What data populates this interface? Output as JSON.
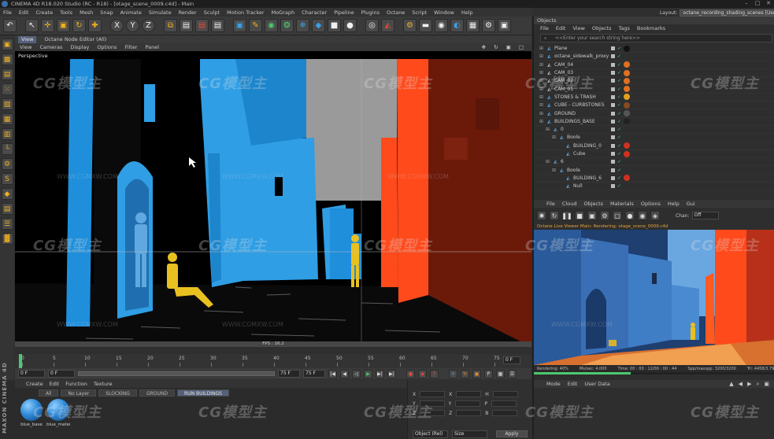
{
  "window": {
    "title": "CINEMA 4D R18.020 Studio (RC - R18) - [otage_scene_0009.c4d] - Main",
    "controls": [
      "–",
      "□",
      "✕"
    ]
  },
  "menubar": [
    "File",
    "Edit",
    "Create",
    "Tools",
    "Mesh",
    "Snap",
    "Animate",
    "Simulate",
    "Render",
    "Sculpt",
    "Motion Tracker",
    "MoGraph",
    "Character",
    "Pipeline",
    "Plugins",
    "Octane",
    "Script",
    "Window",
    "Help"
  ],
  "layout": {
    "label": "Layout:",
    "value": "octane_recording_shading_scenes [User]"
  },
  "toolbar": {
    "group1": [
      {
        "name": "undo-icon",
        "glyph": "↶",
        "tone": "w"
      }
    ],
    "group2": [
      {
        "name": "cursor-icon",
        "glyph": "↖",
        "tone": "w"
      },
      {
        "name": "move-icon",
        "glyph": "✛",
        "tone": "y"
      },
      {
        "name": "scale-icon",
        "glyph": "▣",
        "tone": "y"
      },
      {
        "name": "rotate-icon",
        "glyph": "↻",
        "tone": "y"
      },
      {
        "name": "add-object-icon",
        "glyph": "✚",
        "tone": "y"
      }
    ],
    "axes": [
      "X",
      "Y",
      "Z"
    ],
    "group3": [
      {
        "name": "coord-system-icon",
        "glyph": "⧉",
        "tone": "y"
      },
      {
        "name": "clapper-icon",
        "glyph": "▤",
        "tone": "w"
      },
      {
        "name": "render-view-icon",
        "glyph": "▤",
        "tone": "r"
      },
      {
        "name": "render-settings-icon",
        "glyph": "▤",
        "tone": "w"
      }
    ],
    "group4": [
      {
        "name": "cube-icon",
        "glyph": "▣",
        "tone": "b"
      },
      {
        "name": "pen-icon",
        "glyph": "✎",
        "tone": "y"
      },
      {
        "name": "subdivision-icon",
        "glyph": "◉",
        "tone": "g"
      },
      {
        "name": "array-icon",
        "glyph": "❂",
        "tone": "g"
      },
      {
        "name": "deformer-icon",
        "glyph": "✵",
        "tone": "b"
      },
      {
        "name": "field-icon",
        "glyph": "◆",
        "tone": "b"
      },
      {
        "name": "camera-icon",
        "glyph": "■",
        "tone": "w"
      },
      {
        "name": "light-icon",
        "glyph": "●",
        "tone": "w"
      }
    ],
    "group5": [
      {
        "name": "snap-icon",
        "glyph": "◎",
        "tone": "w"
      },
      {
        "name": "model-mode-icon",
        "glyph": "◭",
        "tone": "r"
      }
    ],
    "group6": [
      {
        "name": "octane-live-icon",
        "glyph": "⚙",
        "tone": "y"
      },
      {
        "name": "octane-toggle-icon",
        "glyph": "▬",
        "tone": "w"
      },
      {
        "name": "octane-material-icon",
        "glyph": "◉",
        "tone": "w"
      },
      {
        "name": "octane-daylight-icon",
        "glyph": "◐",
        "tone": "b"
      },
      {
        "name": "octane-settings-icon",
        "glyph": "▦",
        "tone": "w"
      },
      {
        "name": "gear-icon",
        "glyph": "⚙",
        "tone": "w"
      },
      {
        "name": "lock-icon",
        "glyph": "▣",
        "tone": "w"
      }
    ]
  },
  "lefttools": [
    {
      "name": "model-icon",
      "glyph": "▣"
    },
    {
      "name": "texture-icon",
      "glyph": "▩"
    },
    {
      "name": "workplane-icon",
      "glyph": "▤"
    },
    {
      "name": "points-icon",
      "glyph": "⁙"
    },
    {
      "name": "edges-icon",
      "glyph": "▧"
    },
    {
      "name": "polygons-icon",
      "glyph": "▦"
    },
    {
      "name": "uvw-icon",
      "glyph": "▥"
    },
    {
      "name": "axis-icon",
      "glyph": "└"
    },
    {
      "name": "tweak-icon",
      "glyph": "⚙"
    },
    {
      "name": "snapping-icon",
      "glyph": "S"
    },
    {
      "name": "magnet-icon",
      "glyph": "◆"
    },
    {
      "name": "workplane-lock-icon",
      "glyph": "▤"
    },
    {
      "name": "grid-icon",
      "glyph": "☰"
    },
    {
      "name": "stats-icon",
      "glyph": "▓"
    }
  ],
  "viewport": {
    "tab": "View",
    "tab_title": "Octane Node Editor (All)",
    "menu": [
      "View",
      "Cameras",
      "Display",
      "Options",
      "Filter",
      "Panel"
    ],
    "nav_icons": "✥ ↻ ▣ □",
    "label": "Perspective",
    "fps": "FPS : 16.2"
  },
  "timeline": {
    "ticks": [
      "0",
      "5",
      "10",
      "15",
      "20",
      "25",
      "30",
      "35",
      "40",
      "45",
      "50",
      "55",
      "60",
      "65",
      "70",
      "75"
    ],
    "end": "0 F"
  },
  "transport": {
    "start": "0 F",
    "current": "0 F",
    "end": "75 F",
    "end2": "75 F"
  },
  "material_manager": {
    "menu": [
      "Create",
      "Edit",
      "Function",
      "Texture"
    ],
    "tabs": [
      "All",
      "No Layer",
      "SLOCKING",
      "GROUND",
      "RUN BUILDINGS"
    ],
    "active_tab": "RUN BUILDINGS",
    "materials": [
      {
        "label": "blue_base"
      },
      {
        "label": "blue_mater"
      }
    ]
  },
  "maxon": "MAXON CINEMA 4D",
  "coords": {
    "rows": [
      {
        "a": "X",
        "b": "X",
        "c": "H"
      },
      {
        "a": "Y",
        "b": "Y",
        "c": "P"
      },
      {
        "a": "Z",
        "b": "Z",
        "c": "B"
      }
    ],
    "mode": "Object (Rel)",
    "size": "Size",
    "apply": "Apply"
  },
  "objects": {
    "title": "Objects",
    "menu": [
      "File",
      "Edit",
      "View",
      "Objects",
      "Tags",
      "Bookmarks"
    ],
    "search_placeholder": "<<Enter your search string here>>",
    "rows": [
      {
        "name": "Plane",
        "indent": 0,
        "tag": "#111111"
      },
      {
        "name": "octane_sidewalk_proxy",
        "indent": 0,
        "tag": ""
      },
      {
        "name": "CAM_04",
        "indent": 0,
        "tag": "#e07020"
      },
      {
        "name": "CAM_03",
        "indent": 0,
        "tag": "#e07020"
      },
      {
        "name": "CAM_02",
        "indent": 0,
        "tag": "#e07020"
      },
      {
        "name": "CAM_01",
        "indent": 0,
        "tag": "#e07020"
      },
      {
        "name": "STONES & TRASH",
        "indent": 0,
        "tag": "#e0a020"
      },
      {
        "name": "CUBE - CURBSTONES",
        "indent": 0,
        "tag": "#8a4a20"
      },
      {
        "name": "GROUND",
        "indent": 0,
        "tag": "#555555"
      },
      {
        "name": "BUILDINGS_BASE",
        "indent": 0,
        "tag": "#222222"
      },
      {
        "name": "0",
        "indent": 1,
        "tag": ""
      },
      {
        "name": "Boole",
        "indent": 2,
        "tag": ""
      },
      {
        "name": "BUILDING_0",
        "indent": 3,
        "tag": "#d03020"
      },
      {
        "name": "Cube",
        "indent": 3,
        "tag": "#d03020"
      },
      {
        "name": "6",
        "indent": 1,
        "tag": ""
      },
      {
        "name": "Boole",
        "indent": 2,
        "tag": ""
      },
      {
        "name": "BUILDING_6",
        "indent": 3,
        "tag": "#d03020"
      },
      {
        "name": "Null",
        "indent": 3,
        "tag": ""
      }
    ]
  },
  "render_view": {
    "menu": [
      "File",
      "Cloud",
      "Objects",
      "Materials",
      "Options",
      "Help",
      "Gui"
    ],
    "channel_label": "Chan:",
    "channel_value": "Off",
    "info": "Octane Live Viewer  Main:  Rendering: otage_scene_0009.c4d",
    "status": [
      "Rendering: 40%",
      "Ms/sec: 4.000",
      "Time: 00 : 00 : 12/00 : 00 : 44",
      "Spp/maxspp: 3200/3200",
      "Tri: 4458/3.790m",
      "Mesh: 1A",
      "Hai"
    ],
    "progress": 0.4
  },
  "attributes": {
    "menu": [
      "Mode",
      "Edit",
      "User Data"
    ]
  },
  "watermarks": {
    "logo": "CG模型主",
    "url": "WWW.CGMXW.COM"
  },
  "colors": {
    "blue": "#2f9ee5",
    "red": "#ff4a1c",
    "maroon": "#6b1a0a",
    "gray": "#9a9a9a",
    "yellow": "#e8c020"
  }
}
